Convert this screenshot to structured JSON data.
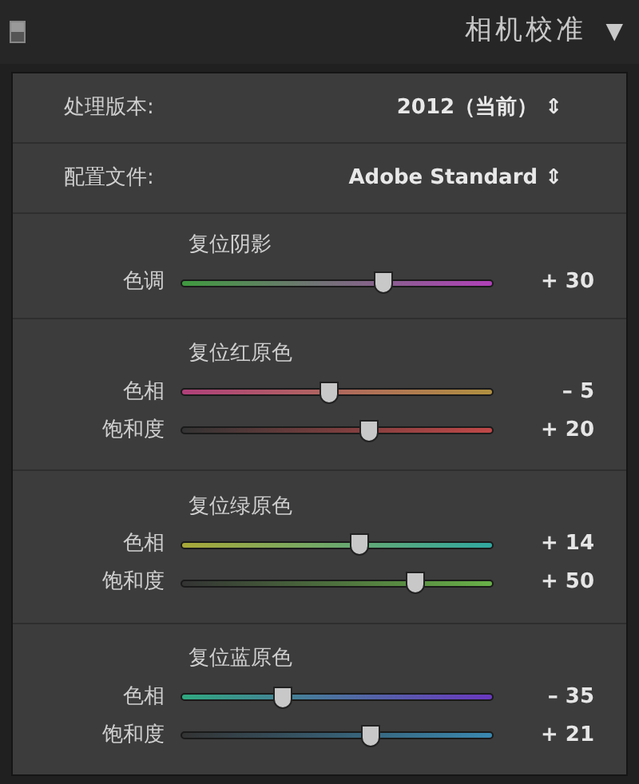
{
  "panel": {
    "title": "相机校准",
    "expanded": true,
    "collapse_glyph": "▼"
  },
  "process": {
    "label": "处理版本:",
    "value": "2012（当前）",
    "arrows": "⇕"
  },
  "profile": {
    "label": "配置文件:",
    "value": "Adobe Standard",
    "arrows": "⇕"
  },
  "sections": [
    {
      "title": "复位阴影",
      "kind": "shadows",
      "sliders": [
        {
          "label": "色调",
          "kind": "tone",
          "level": 0.65,
          "reading": "+ 30"
        }
      ]
    },
    {
      "title": "复位红原色",
      "kind": "red",
      "sliders": [
        {
          "label": "色相",
          "kind": "hue",
          "level": 0.475,
          "reading": "– 5"
        },
        {
          "label": "饱和度",
          "kind": "saturation",
          "level": 0.6,
          "reading": "+ 20"
        }
      ]
    },
    {
      "title": "复位绿原色",
      "kind": "green",
      "sliders": [
        {
          "label": "色相",
          "kind": "hue",
          "level": 0.57,
          "reading": "+ 14"
        },
        {
          "label": "饱和度",
          "kind": "saturation",
          "level": 0.75,
          "reading": "+ 50"
        }
      ]
    },
    {
      "title": "复位蓝原色",
      "kind": "blue",
      "sliders": [
        {
          "label": "色相",
          "kind": "hue",
          "level": 0.325,
          "reading": "– 35"
        },
        {
          "label": "饱和度",
          "kind": "saturation",
          "level": 0.605,
          "reading": "+ 21"
        }
      ]
    }
  ]
}
